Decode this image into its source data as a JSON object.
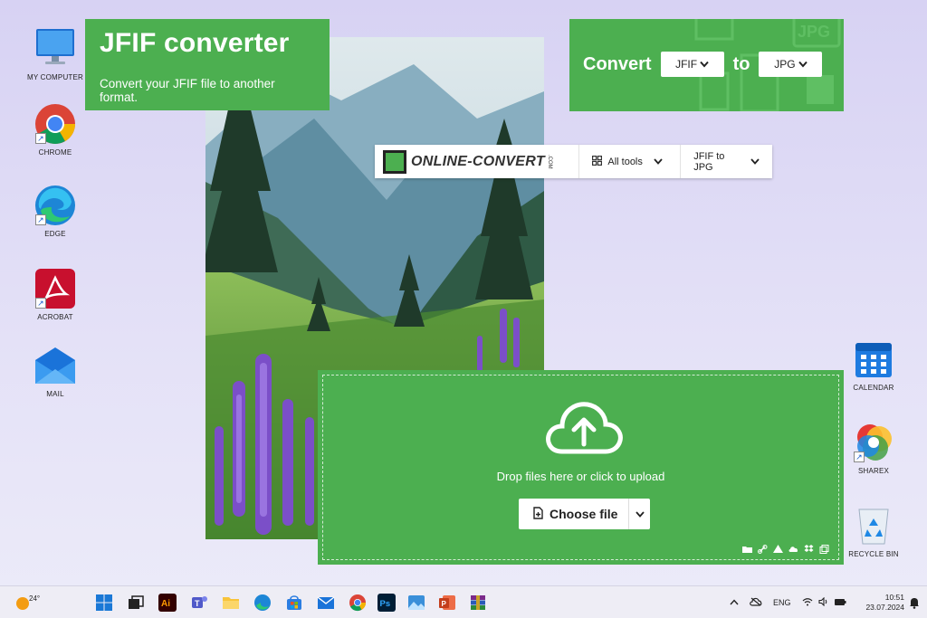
{
  "desktop": {
    "left_icons": [
      {
        "label": "MY COMPUTER",
        "icon": "monitor-icon"
      },
      {
        "label": "CHROME",
        "icon": "chrome-icon"
      },
      {
        "label": "EDGE",
        "icon": "edge-icon"
      },
      {
        "label": "ACROBAT",
        "icon": "acrobat-icon"
      },
      {
        "label": "MAIL",
        "icon": "mail-icon"
      }
    ],
    "right_icons": [
      {
        "label": "CALENDAR",
        "icon": "calendar-icon"
      },
      {
        "label": "SHAREX",
        "icon": "sharex-icon"
      },
      {
        "label": "RECYCLE BIN",
        "icon": "recycle-bin-icon"
      }
    ]
  },
  "title_card": {
    "title": "JFIF converter",
    "subtitle": "Convert your JFIF file to another format."
  },
  "convert_card": {
    "convert_label": "Convert",
    "from_value": "JFIF",
    "to_label": "to",
    "to_value": "JPG",
    "background_format": "JPG"
  },
  "navbar": {
    "logo_text": "ONLINE-CONVERT",
    "logo_suffix": ".COM",
    "all_tools_label": "All tools",
    "conversion_label": "JFIF to JPG"
  },
  "upload": {
    "drop_text": "Drop files here or click to upload",
    "choose_file_label": "Choose file",
    "sources": [
      "folder-icon",
      "link-icon",
      "google-drive-icon",
      "onedrive-icon",
      "dropbox-icon",
      "copy-icon"
    ]
  },
  "taskbar": {
    "weather_temp": "24°",
    "apps": [
      "windows-start-icon",
      "task-view-icon",
      "illustrator-icon",
      "teams-icon",
      "file-explorer-icon",
      "edge-icon",
      "store-icon",
      "mail-icon",
      "chrome-icon",
      "photoshop-icon",
      "photos-icon",
      "powerpoint-icon",
      "winrar-icon"
    ],
    "language": "ENG",
    "time": "10:51",
    "date": "23.07.2024"
  },
  "colors": {
    "brand_green": "#4caf50",
    "desktop_bg": "#d9d4f3",
    "taskbar_bg": "#eeedf5"
  }
}
